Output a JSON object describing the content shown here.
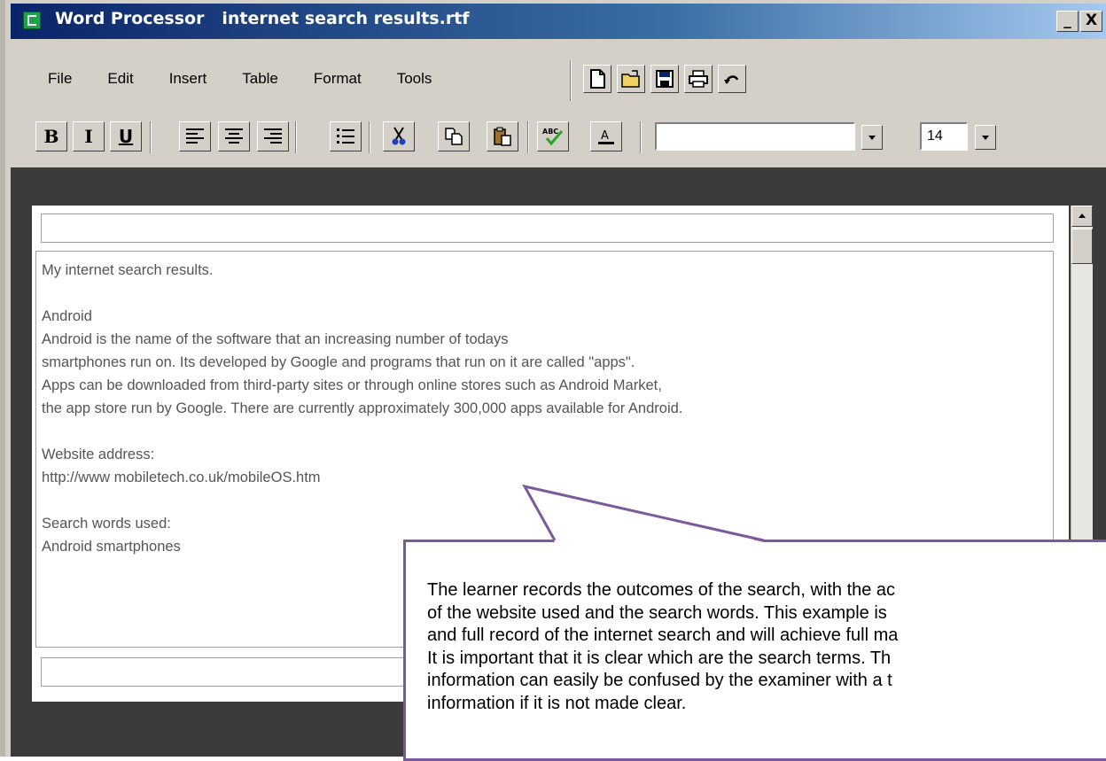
{
  "window": {
    "app_name": "Word Processor",
    "file_name": "internet search results.rtf",
    "minimize": "_",
    "close": "X"
  },
  "menu": [
    "File",
    "Edit",
    "Insert",
    "Table",
    "Format",
    "Tools"
  ],
  "toolbar": {
    "icons": [
      "new-document-icon",
      "open-folder-icon",
      "save-icon",
      "print-icon",
      "undo-icon"
    ]
  },
  "format_bar": {
    "bold": "B",
    "italic": "I",
    "underline": "U",
    "font_name": "",
    "font_size": "14"
  },
  "document": {
    "header_field": "",
    "lines": [
      "My internet search results.",
      "",
      "Android",
      "Android is the name of the software that an increasing number of todays",
      "smartphones run on. Its developed by Google and programs that run on it are called \"apps\".",
      "Apps can be downloaded from third-party sites or through online stores such as Android Market,",
      "the app store run by Google. There are currently approximately 300,000 apps available for Android.",
      "",
      "Website address:",
      "http://www mobiletech.co.uk/mobileOS.htm",
      "",
      "Search words used:",
      "Android smartphones"
    ],
    "footer_field": ""
  },
  "callout": {
    "lines": [
      "The learner records the outcomes of the search, with the ac",
      "of the website used and the search words. This example is",
      "and full record of the internet search and will achieve full ma",
      "It is important that it is clear which are the search terms. Th",
      "information can easily be confused by the examiner with a t",
      "information if it is not made clear."
    ],
    "border_color": "#7b5a9c"
  }
}
